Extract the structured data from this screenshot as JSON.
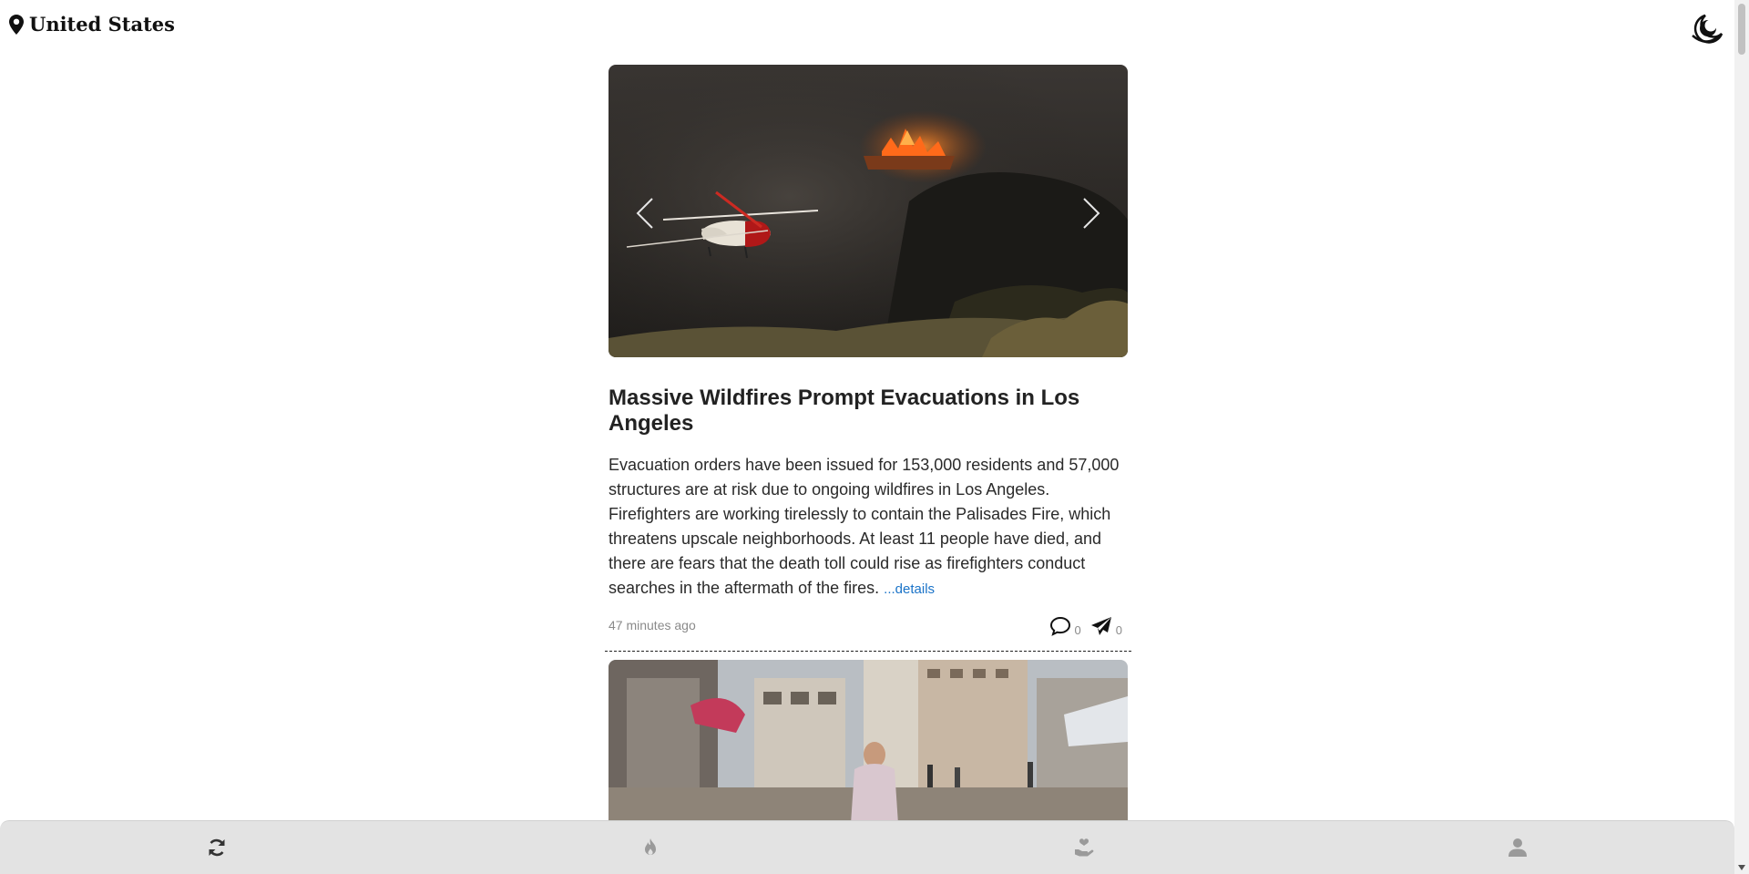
{
  "header": {
    "location_label": "United States",
    "location_icon": "map-pin-icon",
    "theme_icon": "theme-toggle-icon"
  },
  "articles": [
    {
      "title": "Massive Wildfires Prompt Evacuations in Los Angeles",
      "summary": "Evacuation orders have been issued for 153,000 residents and 57,000 structures are at risk due to ongoing wildfires in Los Angeles. Firefighters are working tirelessly to contain the Palisades Fire, which threatens upscale neighborhoods. At least 11 people have died, and there are fears that the death toll could rise as firefighters conduct searches in the aftermath of the fires.",
      "details_label": "...details",
      "timestamp": "47 minutes ago",
      "comments_count": "0",
      "shares_count": "0"
    }
  ],
  "bottom_nav": [
    {
      "icon": "refresh-icon",
      "active": true
    },
    {
      "icon": "flame-icon",
      "active": false
    },
    {
      "icon": "hand-heart-icon",
      "active": false
    },
    {
      "icon": "user-icon",
      "active": false
    }
  ],
  "colors": {
    "link": "#1a73c8",
    "nav_background": "#e3e3e3",
    "nav_active": "#333333",
    "nav_inactive": "#9a9a9a"
  }
}
